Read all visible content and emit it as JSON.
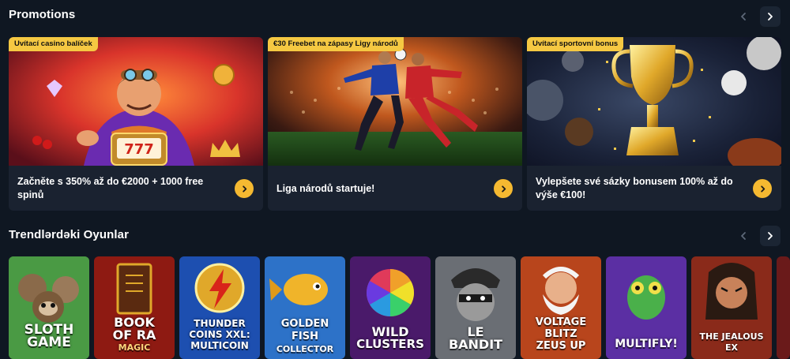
{
  "promotions": {
    "title": "Promotions",
    "items": [
      {
        "badge": "Uvítací casino balíček",
        "text": "Začněte s 350% až do €2000 + 1000 free spinů",
        "image": "casino-character-slot-777"
      },
      {
        "badge": "€30 Freebet na zápasy Ligy národů",
        "text": "Liga národů startuje!",
        "image": "football-players-stadium"
      },
      {
        "badge": "Uvítací sportovní bonus",
        "text": "Vylepšete své sázky bonusem 100% až do výše €100!",
        "image": "golden-trophy-sports-balls"
      }
    ]
  },
  "trending": {
    "title": "Trendlərdəki Oyunlar",
    "games": [
      {
        "line1": "SLOTH",
        "line2": "GAME",
        "color": "#3f8a3a"
      },
      {
        "line1": "BOOK",
        "line2": "OF RA",
        "line3": "MAGIC",
        "color": "#8e1a12"
      },
      {
        "line1": "THUNDER",
        "line2": "COINS XXL:",
        "line3": "MULTICOIN",
        "color": "#1d4fb0"
      },
      {
        "line1": "GOLDEN",
        "line2": "FISH",
        "line3": "COLLECTOR",
        "color": "#2d72c8"
      },
      {
        "line1": "WILD",
        "line2": "CLUSTERS",
        "color": "#6a2a8c"
      },
      {
        "line1": "LE",
        "line2": "BANDIT",
        "color": "#5a5e64"
      },
      {
        "line1": "VOLTAGE",
        "line2": "BLITZ",
        "line3": "ZEUS UP",
        "color": "#b8451c"
      },
      {
        "line1": "MULTIFLY!",
        "color": "#5b2fa3"
      },
      {
        "line1": "THE JEALOUS",
        "line2": "EX",
        "color": "#8a2a1a"
      }
    ]
  },
  "icons": {
    "prev": "chevron-left-icon",
    "next": "chevron-right-icon",
    "go": "chevron-right-icon"
  },
  "colors": {
    "background": "#0f1722",
    "card": "#1a2230",
    "accent": "#f5c842",
    "button": "#f5b931"
  }
}
